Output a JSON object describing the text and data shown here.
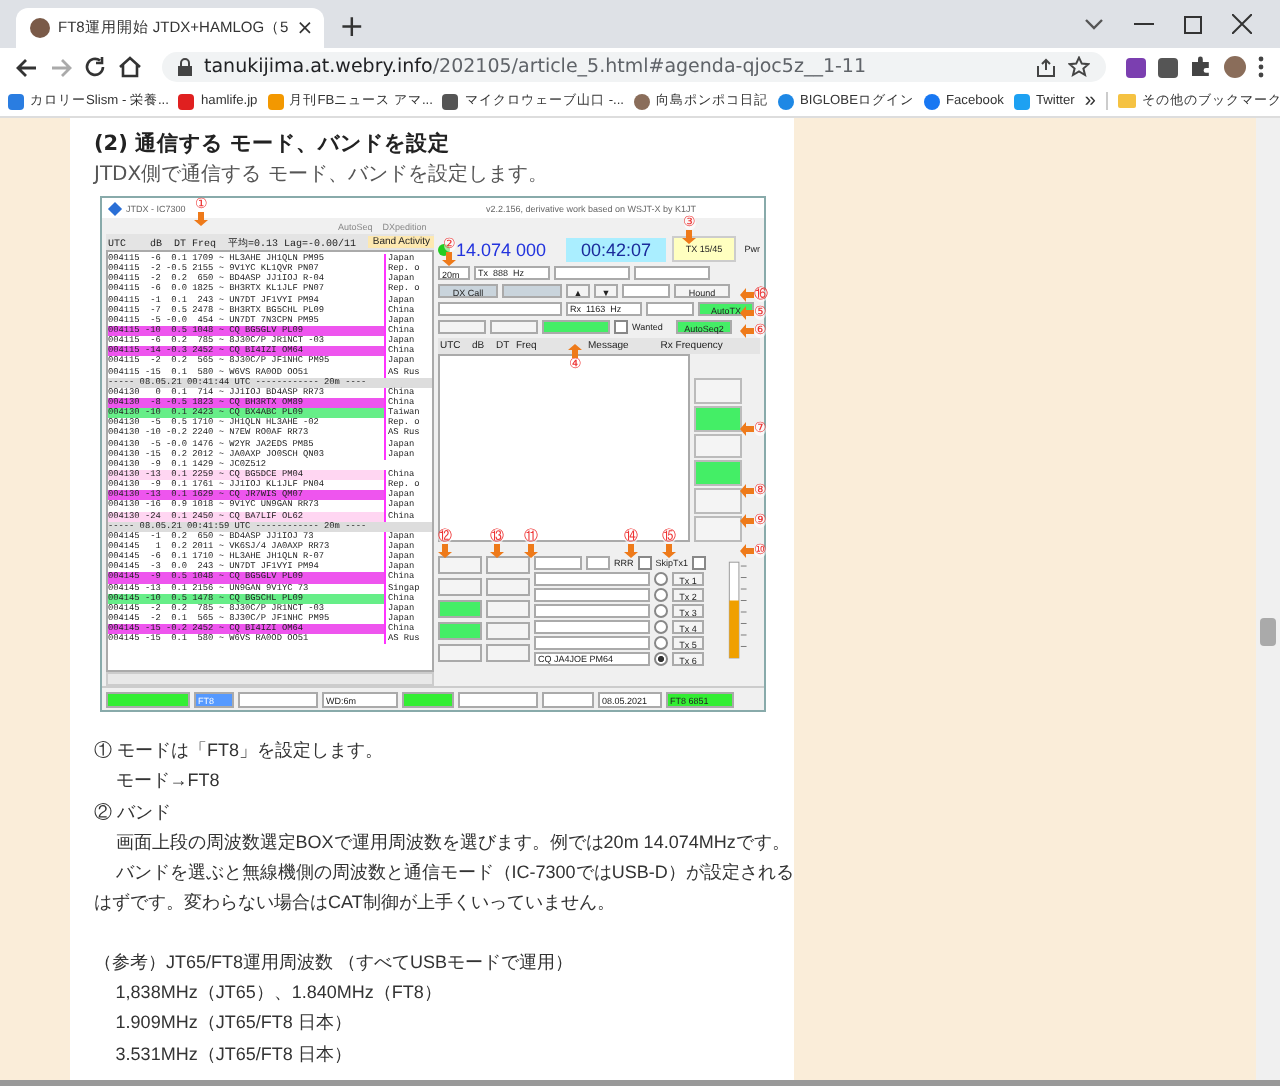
{
  "browser": {
    "tab": {
      "title": "FT8運用開始 JTDX+HAMLOG（5",
      "close": "×"
    },
    "new_tab": "+",
    "address": {
      "host": "tanukijima.at.webry.info",
      "path": "/202105/article_5.html#agenda-qjoc5z__1-11"
    },
    "bookmarks": [
      {
        "label": "カロリーSlism - 栄養...",
        "kind": "slism"
      },
      {
        "label": "hamlife.jp",
        "kind": "hamlife"
      },
      {
        "label": "月刊FBニュース アマ...",
        "kind": "fb"
      },
      {
        "label": "マイクロウェーブ山口 -...",
        "kind": "mw"
      },
      {
        "label": "向島ポンポコ日記",
        "kind": "avatar"
      },
      {
        "label": "BIGLOBEログイン",
        "kind": "globe"
      },
      {
        "label": "Facebook",
        "kind": "facebook"
      },
      {
        "label": "Twitter",
        "kind": "twitter"
      }
    ],
    "more": "»",
    "other_bookmarks": "その他のブックマーク"
  },
  "article": {
    "heading": "(2) 通信する モード、バンドを設定",
    "lead": "JTDX側で通信する モード、バンドを設定します。",
    "screenshot": {
      "title": "JTDX - IC7300",
      "title_right": "v2.2.156, derivative work based on WSJT-X by K1JT",
      "menu": [
        "AutoSeq",
        "DXpedition"
      ],
      "list_header": "UTC    dB  DT Freq  平均=0.13 Lag=-0.00/11",
      "band_activity": "Band Activity",
      "rows": [
        {
          "kind": "plain",
          "text": "004115  -6  0.1 1709 ~ HL3AHE JH1QLN PM95",
          "country": "Japan"
        },
        {
          "kind": "plain",
          "text": "004115  -2 -0.5 2155 ~ 9V1YC KL1QVR PN07",
          "country": "Rep. o"
        },
        {
          "kind": "plain",
          "text": "004115  -2  0.2  650 ~ BD4ASP JJ1IOJ R-04",
          "country": "Japan"
        },
        {
          "kind": "plain",
          "text": "004115  -6  0.0 1825 ~ BH3RTX KL1JLF PN07",
          "country": "Rep. o"
        },
        {
          "kind": "plain",
          "text": "004115  -1  0.1  243 ~ UN7DT JF1VYI PM94",
          "country": "Japan"
        },
        {
          "kind": "plain",
          "text": "004115  -7  0.5 2478 ~ BH3RTX BG5CHL PL09",
          "country": "China"
        },
        {
          "kind": "plain",
          "text": "004115  -5 -0.0  454 ~ UN7DT 7N3CPN PM95",
          "country": "Japan"
        },
        {
          "kind": "cq",
          "text": "004115 -10  0.5 1048 ~ CQ BG5GLV PL09",
          "country": "China"
        },
        {
          "kind": "plain",
          "text": "004115  -6  0.2  785 ~ 8J30C/P JR1NCT -03",
          "country": "Japan"
        },
        {
          "kind": "cq",
          "text": "004115 -14 -0.3 2452 ~ CQ BI4IZI OM64",
          "country": "China"
        },
        {
          "kind": "plain",
          "text": "004115  -2  0.2  565 ~ 8J30C/P JF1NHC PM95",
          "country": "Japan"
        },
        {
          "kind": "plain",
          "text": "004115 -15  0.1  580 ~ W6VS RA0OD OO51",
          "country": "AS Rus"
        },
        {
          "kind": "sep",
          "text": "----- 08.05.21 00:41:44 UTC ------------ 20m ----",
          "country": ""
        },
        {
          "kind": "plain",
          "text": "004130   0  0.1  714 ~ JJ1IOJ BD4ASP RR73",
          "country": "China"
        },
        {
          "kind": "cq",
          "text": "004130  -8 -0.5 1823 ~ CQ BH3RTX OM89",
          "country": "China"
        },
        {
          "kind": "new",
          "text": "004130 -10  0.1 2423 ~ CQ BX4ABC PL09",
          "country": "Taiwan"
        },
        {
          "kind": "plain",
          "text": "004130  -5  0.5 1710 ~ JH1QLN HL3AHE -02",
          "country": "Rep. o"
        },
        {
          "kind": "plain",
          "text": "004130 -10 -0.2 2240 ~ N7EW RO0AF RR73",
          "country": "AS Rus"
        },
        {
          "kind": "plain",
          "text": "004130  -5 -0.0 1476 ~ W2YR JA2EDS PM85",
          "country": "Japan"
        },
        {
          "kind": "plain",
          "text": "004130 -15  0.2 2012 ~ JA0AXP JO0SCH QN03",
          "country": "Japan"
        },
        {
          "kind": "plain",
          "text": "004130  -9  0.1 1429 ~ JC0Z512",
          "country": ""
        },
        {
          "kind": "old",
          "text": "004130 -13  0.1 2259 ~ CQ BG5DCE PM04",
          "country": "China"
        },
        {
          "kind": "plain",
          "text": "004130  -9  0.1 1761 ~ JJ1IOJ KL1JLF PN04",
          "country": "Rep. o"
        },
        {
          "kind": "cq",
          "text": "004130 -13  0.1 1629 ~ CQ JR7WIS QM07",
          "country": "Japan"
        },
        {
          "kind": "plain",
          "text": "004130 -16  0.9 1018 ~ 9V1YC UN9GAN RR73",
          "country": "Japan"
        },
        {
          "kind": "old",
          "text": "004130 -24  0.1 2450 ~ CQ BA7LIF OL62",
          "country": "China"
        },
        {
          "kind": "sep",
          "text": "----- 08.05.21 00:41:59 UTC ------------ 20m ----",
          "country": ""
        },
        {
          "kind": "plain",
          "text": "004145  -1  0.2  650 ~ BD4ASP JJ1IOJ 73",
          "country": "Japan"
        },
        {
          "kind": "plain",
          "text": "004145   1  0.2 2011 ~ VK6SJ/4 JA0AXP RR73",
          "country": "Japan"
        },
        {
          "kind": "plain",
          "text": "004145  -6  0.1 1710 ~ HL3AHE JH1QLN R-07",
          "country": "Japan"
        },
        {
          "kind": "plain",
          "text": "004145  -3  0.0  243 ~ UN7DT JF1VYI PM94",
          "country": "Japan"
        },
        {
          "kind": "cq",
          "text": "004145  -9  0.5 1048 ~ CQ BG5GLV PL09",
          "country": "China"
        },
        {
          "kind": "plain",
          "text": "004145 -13  0.1 2156 ~ UN9GAN 9V1YC 73",
          "country": "Singap"
        },
        {
          "kind": "new",
          "text": "004145 -10  0.5 1478 ~ CQ BG5CHL PL09",
          "country": "China"
        },
        {
          "kind": "plain",
          "text": "004145  -2  0.2  785 ~ 8J30C/P JR1NCT -03",
          "country": "Japan"
        },
        {
          "kind": "plain",
          "text": "004145  -2  0.1  565 ~ 8J30C/P JF1NHC PM95",
          "country": "Japan"
        },
        {
          "kind": "cq",
          "text": "004145 -15 -0.2 2452 ~ CQ BI4IZI OM64",
          "country": "China"
        },
        {
          "kind": "plain",
          "text": "004145 -15  0.1  580 ~ W6VS RA0OD OO51",
          "country": "AS Rus"
        }
      ],
      "band": "20m",
      "frequency": "14.074 000",
      "clock": "00:42:07",
      "tx_period": "TX 15/45",
      "pwr": "Pwr",
      "tx_offset": "Tx  888  Hz",
      "rx_offset": "Rx  1163  Hz",
      "dx_call": "DX Call",
      "hound": "Hound",
      "auto_tx": "AutoTX",
      "auto_seq": "AutoSeq2",
      "wanted": "Wanted",
      "rx_header": [
        "UTC",
        "dB",
        "DT",
        "Freq",
        "Message"
      ],
      "rx_frequency": "Rx Frequency",
      "side_buttons": [
        {
          "on": false
        },
        {
          "on": true
        },
        {
          "on": false
        },
        {
          "on": true
        },
        {
          "on": false
        },
        {
          "on": false
        }
      ],
      "rrr": "RRR",
      "skip_tx1": "SkipTx1",
      "tx_message": "CQ JA4JOE PM64",
      "tx_buttons": [
        {
          "label": "Tx 1",
          "selected": false
        },
        {
          "label": "Tx 2",
          "selected": false
        },
        {
          "label": "Tx 3",
          "selected": false
        },
        {
          "label": "Tx 4",
          "selected": false
        },
        {
          "label": "Tx 5",
          "selected": false
        },
        {
          "label": "Tx 6",
          "selected": true
        }
      ],
      "rrr_checked": false,
      "skip_tx1_checked": false,
      "wanted_checked": false,
      "arrow_up": "▲",
      "arrow_down": "▼",
      "status_mode": "FT8",
      "status_wd": "WD:6m",
      "status_date": "08.05.2021",
      "status_ft8": "FT8  6851",
      "markers": [
        "①",
        "②",
        "③",
        "④",
        "⑤",
        "⑥",
        "⑦",
        "⑧",
        "⑨",
        "⑩",
        "⑫",
        "⑬",
        "⑪",
        "⑭",
        "⑮",
        "⑯"
      ]
    },
    "paragraphs": [
      {
        "kind": "plain",
        "text": "① モードは「FT8」を設定します。"
      },
      {
        "kind": "indent",
        "text": "モード→FT8"
      },
      {
        "kind": "plain",
        "text": "② バンド"
      },
      {
        "kind": "indent",
        "text": "画面上段の周波数選定BOXで運用周波数を選びます。例では20m 14.074MHzです。"
      },
      {
        "kind": "indent",
        "text": "バンドを選ぶと無線機側の周波数と通信モード（IC-7300ではUSB-D）が設定されるはずです。変わらない場合はCAT制御が上手くいっていません。"
      },
      {
        "kind": "gap",
        "text": "（参考）JT65/FT8運用周波数 （すべてUSBモードで運用）"
      },
      {
        "kind": "indent",
        "text": "1,838MHz（JT65）、1.840MHz（FT8）"
      },
      {
        "kind": "indent",
        "text": "1.909MHz（JT65/FT8 日本）"
      },
      {
        "kind": "indent",
        "text": "3.531MHz（JT65/FT8 日本）"
      }
    ]
  }
}
